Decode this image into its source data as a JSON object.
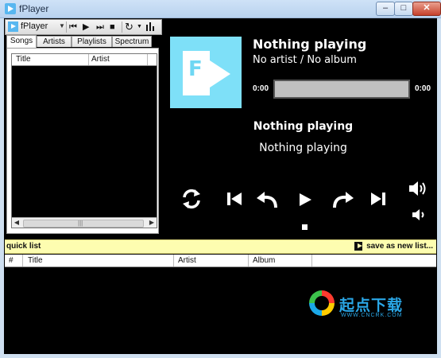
{
  "window": {
    "title": "fPlayer",
    "controls": {
      "minimize": "–",
      "maximize": "□",
      "close": "✕"
    }
  },
  "toolbar": {
    "brand": "fPlayer",
    "icons": [
      "app-logo-icon",
      "previous-icon",
      "play-icon",
      "next-icon",
      "stop-icon",
      "repeat-icon",
      "equalizer-icon"
    ]
  },
  "tabs": [
    {
      "label": "Songs",
      "active": true
    },
    {
      "label": "Artists",
      "active": false
    },
    {
      "label": "Playlists",
      "active": false
    },
    {
      "label": "Spectrum",
      "active": false
    }
  ],
  "library": {
    "columns": [
      "Title",
      "Artist"
    ],
    "scroll_grip": "|||"
  },
  "now_playing": {
    "title": "Nothing playing",
    "subtitle": "No artist / No album",
    "time_elapsed": "0:00",
    "time_total": "0:00",
    "progress_fraction": 0,
    "center_title": "Nothing playing",
    "center_subtitle": "Nothing playing"
  },
  "controls": {
    "icons": [
      "repeat-icon",
      "previous-icon",
      "rewind-icon",
      "play-icon",
      "forward-icon",
      "next-icon",
      "volume-up-icon",
      "volume-down-icon",
      "stop-icon"
    ]
  },
  "quick_list": {
    "title": "quick list",
    "save_label": "save as new list...",
    "columns": [
      "#",
      "Title",
      "Artist",
      "Album"
    ]
  },
  "watermark": {
    "text": "起点下载",
    "url": "WWW.CNCRK.COM"
  },
  "colors": {
    "accent": "#7ee0f8",
    "quick_list_bar": "#fdfdb0",
    "background": "#000000"
  }
}
